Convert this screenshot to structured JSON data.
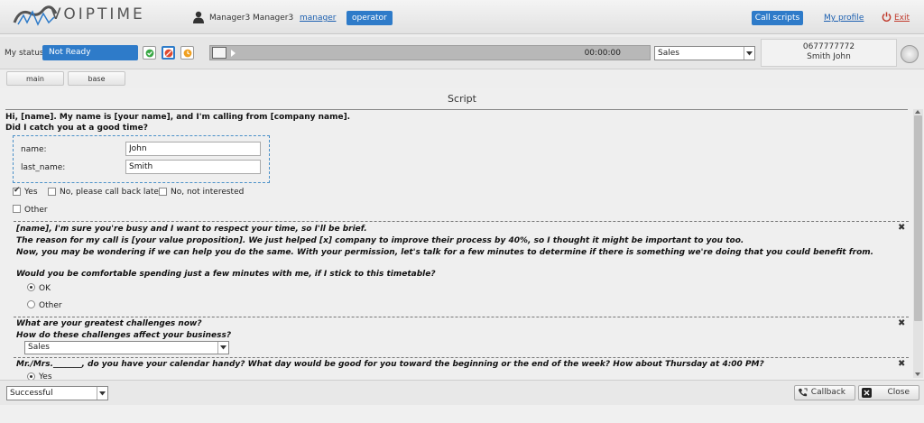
{
  "header": {
    "logo_text": "VOIPTIME",
    "user_name": "Manager3 Manager3",
    "link_manager": "manager",
    "btn_operator": "operator",
    "btn_call_scripts": "Call scripts",
    "link_profile": "My profile",
    "link_exit": "Exit"
  },
  "statusbar": {
    "label": "My status:",
    "status_value": "Not Ready",
    "timer": "00:00:00",
    "queue_value": "Sales",
    "phone": "0677777772",
    "caller_name": "Smith John"
  },
  "tabs": [
    {
      "label": "main"
    },
    {
      "label": "base"
    }
  ],
  "script": {
    "title": "Script",
    "greeting_line1": "Hi, [name]. My name is [your name], and I'm calling from [company name].",
    "greeting_line2": "Did I catch you at a good time?",
    "form": {
      "name_label": "name:",
      "name_value": "John",
      "last_name_label": "last_name:",
      "last_name_value": "Smith"
    },
    "options1": [
      {
        "label": "Yes",
        "checked": true
      },
      {
        "label": "No, please call back later",
        "checked": false
      },
      {
        "label": "No, not interested",
        "checked": false
      },
      {
        "label": "Other",
        "checked": false
      }
    ],
    "section2": {
      "line1": "[name], I'm sure you're busy and I want to respect your time, so I'll be brief.",
      "line2": "The reason for my call is [your value proposition]. We just helped [x] company to improve their process by 40%, so I thought it might be important to you too.",
      "line3": "Now, you may be wondering if we can help you do the same. With your permission, let's talk for a few minutes to determine if there is something we're doing that you could benefit from.",
      "question": "Would you be comfortable spending just a few minutes with me, if I stick to this timetable?",
      "radio_ok": "OK",
      "radio_other": "Other"
    },
    "section3": {
      "line1": "What are your greatest challenges now?",
      "line2": "How do these challenges affect your business?",
      "dropdown_value": "Sales"
    },
    "section4": {
      "line1": "Mr./Mrs._______, do you have your calendar handy? What day would be good for you toward the beginning or the end of the week? How about Thursday at 4:00 PM?",
      "radio_yes": "Yes"
    },
    "close_glyph": "✖"
  },
  "footer": {
    "result_value": "Successful",
    "callback_label": "Callback",
    "close_label": "Close"
  },
  "colors": {
    "accent_blue": "#2e7bc9",
    "exit_red": "#c0392b"
  }
}
